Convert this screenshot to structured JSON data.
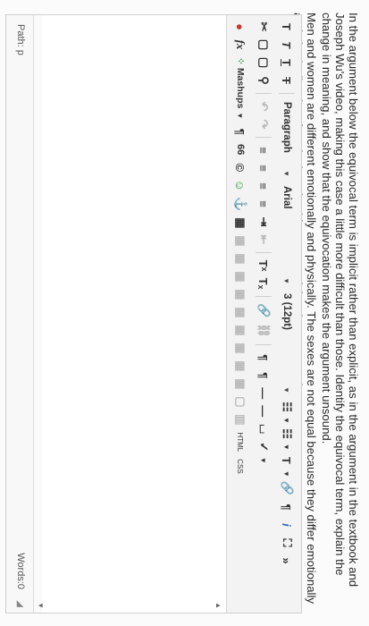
{
  "question": {
    "paragraph1": "In the argument below the equivocal term is implicit rather than explicit, as in the argument in the textbook and Joseph Wu's video, making this case a little more difficult than those. Identify the equivocal term, explain the change in meaning, and show that the equivocation makes the argument unsound.",
    "paragraph2": "Men and women are different emotionally and physically. The sexes are not equal because they differ emotionally and physically. Therefore the law should not pretend that they are equal."
  },
  "toolbar": {
    "row1": {
      "bold": "T",
      "italic": "T",
      "underline": "T",
      "strike": "T",
      "format_select": "Paragraph",
      "font_select": "Arial",
      "size_select": "3 (12pt)",
      "bullets": "☷",
      "numbering": "☷",
      "text_color": "T",
      "link": "🔗",
      "spell": "¶",
      "info": "i",
      "expand": "⛶",
      "collapse": "»"
    },
    "row2": {
      "cut": "✂",
      "copy": "▢",
      "paste": "▢",
      "find": "⚲",
      "undo": "↶",
      "redo": "↷",
      "align_left": "≡",
      "align_center": "≡",
      "align_right": "≡",
      "justify": "≡",
      "indent": "⇥",
      "outdent": "⇤",
      "superscript": "Tˣ",
      "subscript": "Tₓ",
      "link2": "🔗",
      "unlink": "⛓",
      "ltr": "¶",
      "rtl": "¶",
      "hr": "—",
      "hr2": "—",
      "special": "⌴",
      "spell_check": "✓"
    },
    "row3": {
      "record": "●",
      "fx": "fx",
      "mashups": "Mashups",
      "paragraph_mark": "¶",
      "quote": "66",
      "copyright": "©",
      "emoji": "☺",
      "anchor": "⚓",
      "table": "▦",
      "t1": "▦",
      "t2": "▦",
      "t3": "▦",
      "t4": "▦",
      "t5": "▦",
      "t6": "▦",
      "t7": "▦",
      "t8": "▦",
      "t9": "▦",
      "box": "▢",
      "frame": "▥",
      "html": "HTML",
      "css": "CSS"
    }
  },
  "status": {
    "path": "Path: p",
    "words": "Words:0",
    "grip": "◢"
  },
  "colors": {
    "background": "#fbfbfb",
    "toolbar": "#f3f3f3",
    "record": "#c0392b",
    "emoji": "#2e9c3d",
    "anchor": "#2e6fb7"
  }
}
